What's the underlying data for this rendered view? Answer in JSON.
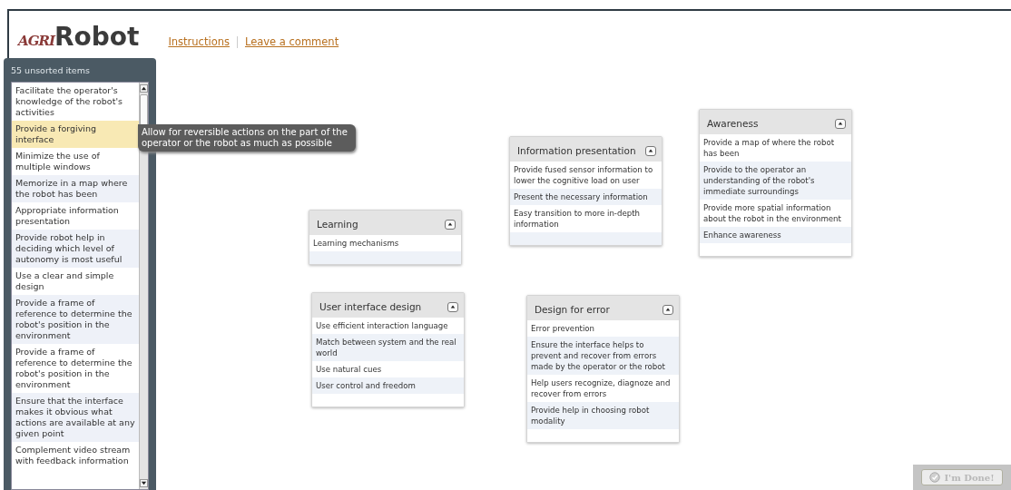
{
  "header": {
    "logo_prefix": "AGRI",
    "logo_main": "Robot",
    "links": [
      "Instructions",
      "Leave a comment"
    ]
  },
  "sidebar": {
    "count_label": "55  unsorted items",
    "items": [
      {
        "text": "Facilitate the operator's knowledge of the robot's activities",
        "selected": false
      },
      {
        "text": "Provide a forgiving interface",
        "selected": true
      },
      {
        "text": "Minimize the use of multiple windows",
        "selected": false
      },
      {
        "text": "Memorize in a map where the robot has been",
        "selected": false
      },
      {
        "text": "Appropriate information presentation",
        "selected": false
      },
      {
        "text": "Provide robot help in deciding which level of autonomy is most useful",
        "selected": false
      },
      {
        "text": "Use a clear and simple design",
        "selected": false
      },
      {
        "text": "Provide a frame of reference to determine the robot's position in the environment",
        "selected": false
      },
      {
        "text": "Provide a frame of reference to determine the robot's  position in the environment",
        "selected": false
      },
      {
        "text": "Ensure that the interface makes it obvious what actions are available at any given point",
        "selected": false
      },
      {
        "text": "Complement video stream with feedback information",
        "selected": false
      }
    ]
  },
  "tooltip": "Allow for reversible actions on the part of the operator or the robot as much as possible",
  "groups": [
    {
      "title": "Learning",
      "items": [
        "Learning mechanisms"
      ]
    },
    {
      "title": "Information presentation",
      "items": [
        "Provide fused sensor information to lower the cognitive load on user",
        "Present the necessary information",
        "Easy transition to more in-depth information"
      ]
    },
    {
      "title": "Awareness",
      "items": [
        "Provide a map of where the robot has been",
        "Provide to the operator an understanding of the robot's immediate surroundings",
        "Provide more spatial information about the robot in the environment",
        "Enhance awareness"
      ]
    },
    {
      "title": "User interface design",
      "items": [
        "Use efficient interaction language",
        "Match between system and the real world",
        "Use natural cues",
        "User control and freedom"
      ]
    },
    {
      "title": "Design for error",
      "items": [
        "Error prevention",
        "Ensure the interface helps to prevent and recover from errors made by the operator or the robot",
        "Help users recognize, diagnoze and recover from errors",
        "Provide help in choosing robot modality"
      ]
    }
  ],
  "done_button": {
    "label": "I'm Done!",
    "disabled": true
  }
}
